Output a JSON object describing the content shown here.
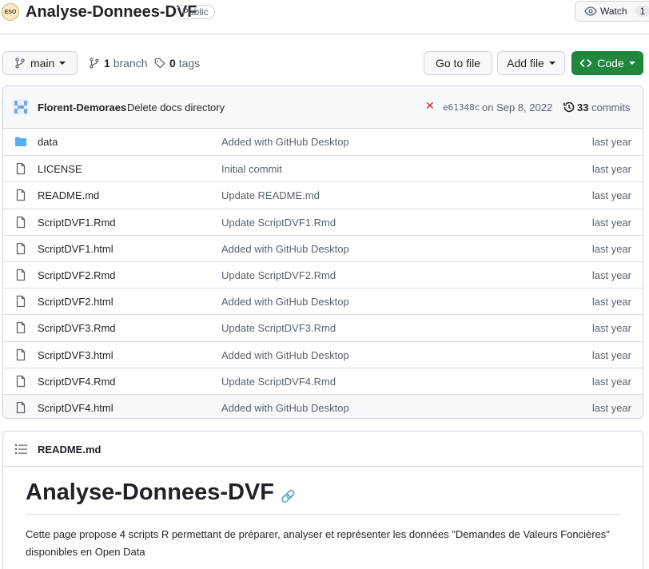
{
  "repo": {
    "avatar_text": "ESO",
    "name": "Analyse-Donnees-DVF",
    "visibility": "Public",
    "watch_label": "Watch",
    "watch_count": "1"
  },
  "toolbar": {
    "branch": "main",
    "branch_count": "1",
    "branch_label": "branch",
    "tag_count": "0",
    "tag_label": "tags",
    "go_to_file": "Go to file",
    "add_file": "Add file",
    "code": "Code"
  },
  "latest_commit": {
    "author": "Florent-Demoraes",
    "message": "Delete docs directory",
    "status": "✕",
    "sha": "e61348c",
    "date": "on Sep 8, 2022",
    "commit_count": "33",
    "commits_label": "commits"
  },
  "files": [
    {
      "type": "folder",
      "name": "data",
      "message": "Added with GitHub Desktop",
      "age": "last year"
    },
    {
      "type": "file",
      "name": "LICENSE",
      "message": "Initial commit",
      "age": "last year"
    },
    {
      "type": "file",
      "name": "README.md",
      "message": "Update README.md",
      "age": "last year"
    },
    {
      "type": "file",
      "name": "ScriptDVF1.Rmd",
      "message": "Update ScriptDVF1.Rmd",
      "age": "last year"
    },
    {
      "type": "file",
      "name": "ScriptDVF1.html",
      "message": "Added with GitHub Desktop",
      "age": "last year"
    },
    {
      "type": "file",
      "name": "ScriptDVF2.Rmd",
      "message": "Update ScriptDVF2.Rmd",
      "age": "last year"
    },
    {
      "type": "file",
      "name": "ScriptDVF2.html",
      "message": "Added with GitHub Desktop",
      "age": "last year"
    },
    {
      "type": "file",
      "name": "ScriptDVF3.Rmd",
      "message": "Update ScriptDVF3.Rmd",
      "age": "last year"
    },
    {
      "type": "file",
      "name": "ScriptDVF3.html",
      "message": "Added with GitHub Desktop",
      "age": "last year"
    },
    {
      "type": "file",
      "name": "ScriptDVF4.Rmd",
      "message": "Update ScriptDVF4.Rmd",
      "age": "last year"
    },
    {
      "type": "file",
      "name": "ScriptDVF4.html",
      "message": "Added with GitHub Desktop",
      "age": "last year"
    }
  ],
  "readme": {
    "filename": "README.md",
    "title": "Analyse-Donnees-DVF",
    "text": "Cette page propose 4 scripts R permettant de préparer, analyser et représenter les données \"Demandes de Valeurs Foncières\" disponibles en Open Data"
  },
  "colors": {
    "primary_button": "#1f883d",
    "folder_icon": "#54aeff",
    "status_error": "#d1242f"
  }
}
